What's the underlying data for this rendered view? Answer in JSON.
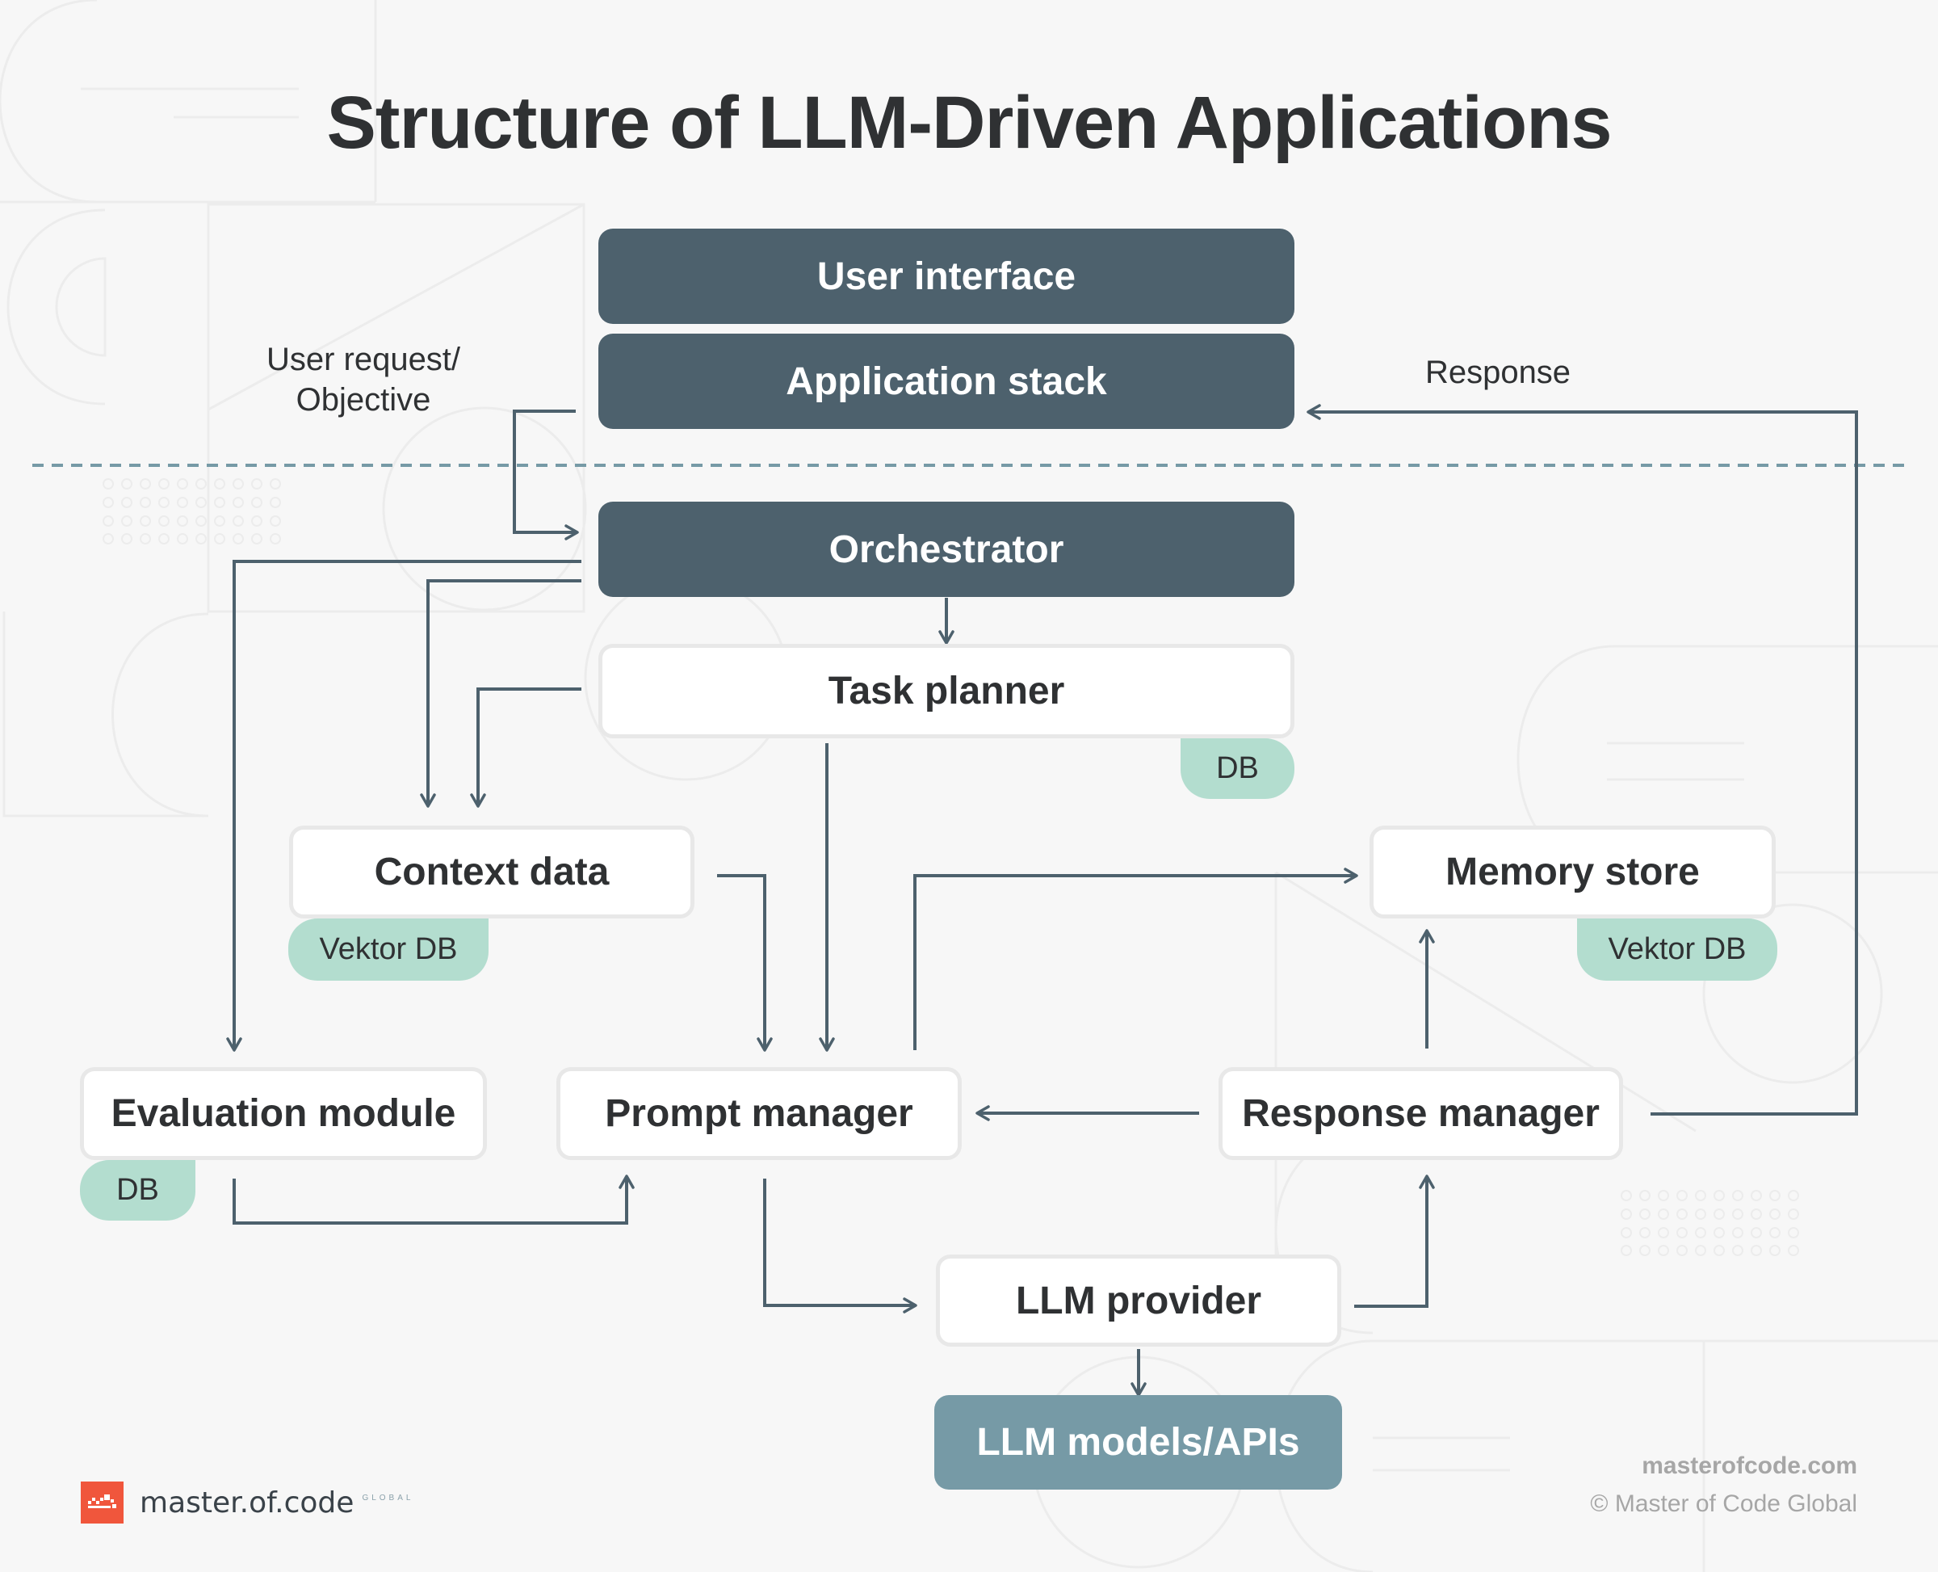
{
  "title": "Structure of LLM-Driven Applications",
  "colors": {
    "dark_box": "#4d616d",
    "light_box": "#ffffff",
    "models_box": "#769aa6",
    "badge": "#b3ddcf",
    "connector": "#4d616d",
    "divider": "#769aa6",
    "logo_accent": "#f0563c"
  },
  "nodes": {
    "user_interface": "User interface",
    "application_stack": "Application stack",
    "orchestrator": "Orchestrator",
    "task_planner": "Task planner",
    "task_planner_badge": "DB",
    "context_data": "Context data",
    "context_data_badge": "Vektor DB",
    "memory_store": "Memory store",
    "memory_store_badge": "Vektor DB",
    "evaluation_module": "Evaluation module",
    "evaluation_module_badge": "DB",
    "prompt_manager": "Prompt manager",
    "response_manager": "Response manager",
    "llm_provider": "LLM provider",
    "llm_models": "LLM models/APIs"
  },
  "labels": {
    "user_request_line1": "User request/",
    "user_request_line2": "Objective",
    "response": "Response"
  },
  "edges": [
    {
      "from": "application_stack",
      "to": "orchestrator",
      "label": "User request/ Objective"
    },
    {
      "from": "response_manager",
      "to": "application_stack",
      "label": "Response"
    },
    {
      "from": "orchestrator",
      "to": "task_planner"
    },
    {
      "from": "orchestrator",
      "to": "evaluation_module"
    },
    {
      "from": "orchestrator",
      "to": "context_data"
    },
    {
      "from": "task_planner",
      "to": "context_data"
    },
    {
      "from": "task_planner",
      "to": "prompt_manager"
    },
    {
      "from": "context_data",
      "to": "prompt_manager"
    },
    {
      "from": "prompt_manager",
      "to": "memory_store"
    },
    {
      "from": "memory_store",
      "to": "prompt_manager"
    },
    {
      "from": "response_manager",
      "to": "memory_store"
    },
    {
      "from": "response_manager",
      "to": "prompt_manager"
    },
    {
      "from": "evaluation_module",
      "to": "prompt_manager"
    },
    {
      "from": "prompt_manager",
      "to": "llm_provider"
    },
    {
      "from": "llm_provider",
      "to": "response_manager"
    },
    {
      "from": "llm_provider",
      "to": "llm_models"
    }
  ],
  "logo": {
    "name": "master.of.code",
    "sub": "GLOBAL"
  },
  "footer": {
    "site": "masterofcode.com",
    "copyright": "© Master of Code Global"
  }
}
